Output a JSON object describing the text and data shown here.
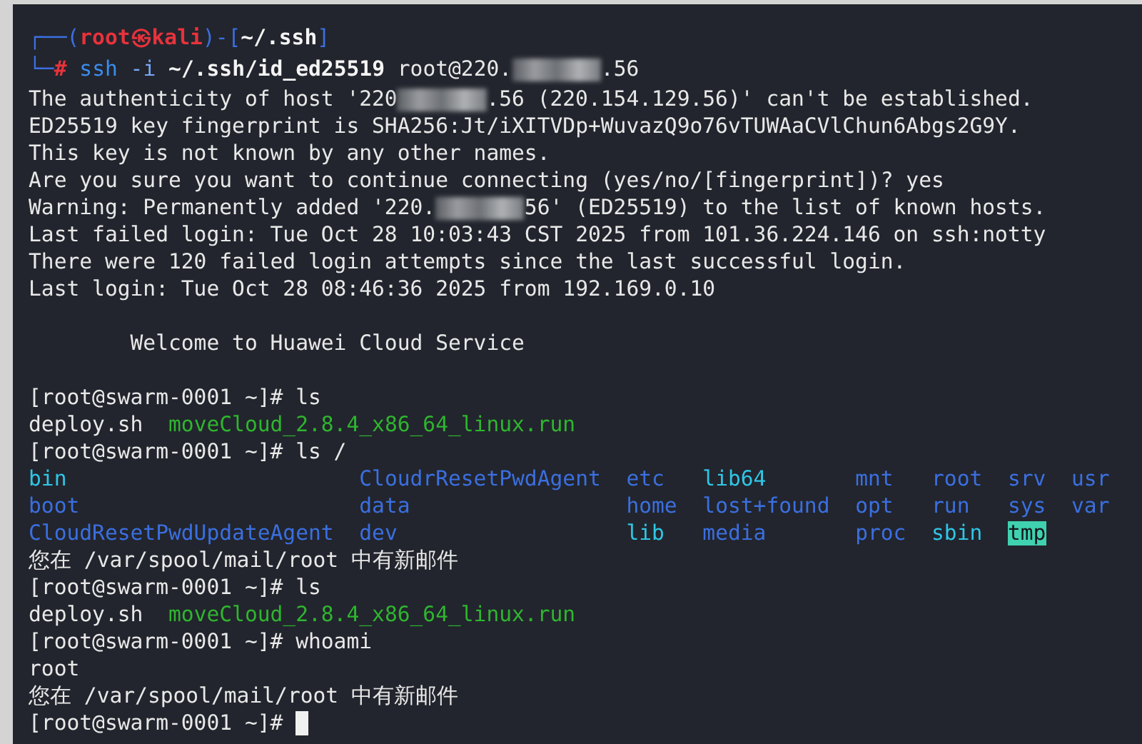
{
  "terminal": {
    "lines": [
      {
        "kind": "text",
        "segments": [
          {
            "kind": "frame",
            "text": "┌──("
          },
          {
            "kind": "user",
            "text": "root㉿kali"
          },
          {
            "kind": "frame",
            "text": ")-["
          },
          {
            "kind": "path",
            "text": "~/.ssh"
          },
          {
            "kind": "frame",
            "text": "]"
          }
        ]
      },
      {
        "kind": "text",
        "segments": [
          {
            "kind": "frame",
            "text": "└─"
          },
          {
            "kind": "user",
            "text": "#"
          },
          {
            "kind": "cmd",
            "text": " ssh"
          },
          {
            "kind": "opt",
            "text": " -i"
          },
          {
            "kind": "path",
            "text": " ~/.ssh/id_ed25519"
          },
          {
            "kind": "plain",
            "text": " root@220."
          },
          {
            "kind": "redacted"
          },
          {
            "kind": "plain",
            "text": ".56"
          }
        ]
      },
      {
        "kind": "text",
        "segments": [
          {
            "kind": "plain",
            "text": "The authenticity of host '220"
          },
          {
            "kind": "redacted"
          },
          {
            "kind": "plain",
            "text": ".56 (220.154.129.56)' can't be established."
          }
        ]
      },
      {
        "kind": "text",
        "segments": [
          {
            "kind": "plain",
            "text": "ED25519 key fingerprint is SHA256:Jt/iXITVDp+WuvazQ9o76vTUWAaCVlChun6Abgs2G9Y."
          }
        ]
      },
      {
        "kind": "text",
        "segments": [
          {
            "kind": "plain",
            "text": "This key is not known by any other names."
          }
        ]
      },
      {
        "kind": "text",
        "segments": [
          {
            "kind": "plain",
            "text": "Are you sure you want to continue connecting (yes/no/[fingerprint])? yes"
          }
        ]
      },
      {
        "kind": "text",
        "segments": [
          {
            "kind": "plain",
            "text": "Warning: Permanently added '220."
          },
          {
            "kind": "redacted"
          },
          {
            "kind": "plain",
            "text": "56' (ED25519) to the list of known hosts."
          }
        ]
      },
      {
        "kind": "text",
        "segments": [
          {
            "kind": "plain",
            "text": "Last failed login: Tue Oct 28 10:03:43 CST 2025 from 101.36.224.146 on ssh:notty"
          }
        ]
      },
      {
        "kind": "text",
        "segments": [
          {
            "kind": "plain",
            "text": "There were 120 failed login attempts since the last successful login."
          }
        ]
      },
      {
        "kind": "text",
        "segments": [
          {
            "kind": "plain",
            "text": "Last login: Tue Oct 28 08:46:36 2025 from 192.169.0.10"
          }
        ]
      },
      {
        "kind": "blank"
      },
      {
        "kind": "text",
        "segments": [
          {
            "kind": "plain",
            "text": "        Welcome to Huawei Cloud Service"
          }
        ]
      },
      {
        "kind": "blank"
      },
      {
        "kind": "text",
        "segments": [
          {
            "kind": "plain",
            "text": "[root@swarm-0001 ~]# ls"
          }
        ]
      },
      {
        "kind": "text",
        "segments": [
          {
            "kind": "plain",
            "text": "deploy.sh  "
          },
          {
            "kind": "exec",
            "text": "moveCloud_2.8.4_x86_64_linux.run"
          }
        ]
      },
      {
        "kind": "text",
        "segments": [
          {
            "kind": "plain",
            "text": "[root@swarm-0001 ~]# ls /"
          }
        ]
      },
      {
        "kind": "listing",
        "entries": [
          {
            "kind": "link",
            "text": "bin"
          },
          {
            "kind": "dir",
            "text": "boot"
          },
          {
            "kind": "dir",
            "text": "CloudResetPwdUpdateAgent"
          },
          {
            "kind": "dir",
            "text": "CloudrResetPwdAgent"
          },
          {
            "kind": "dir",
            "text": "data"
          },
          {
            "kind": "dir",
            "text": "dev"
          },
          {
            "kind": "dir",
            "text": "etc"
          },
          {
            "kind": "dir",
            "text": "home"
          },
          {
            "kind": "link",
            "text": "lib"
          },
          {
            "kind": "link",
            "text": "lib64"
          },
          {
            "kind": "dir",
            "text": "lost+found"
          },
          {
            "kind": "dir",
            "text": "media"
          },
          {
            "kind": "dir",
            "text": "mnt"
          },
          {
            "kind": "dir",
            "text": "opt"
          },
          {
            "kind": "dir",
            "text": "proc"
          },
          {
            "kind": "dir",
            "text": "root"
          },
          {
            "kind": "dir",
            "text": "run"
          },
          {
            "kind": "link",
            "text": "sbin"
          },
          {
            "kind": "dir",
            "text": "srv"
          },
          {
            "kind": "dir",
            "text": "sys"
          },
          {
            "kind": "sticky",
            "text": "tmp"
          },
          {
            "kind": "dir",
            "text": "usr"
          },
          {
            "kind": "dir",
            "text": "var"
          }
        ]
      },
      {
        "kind": "text",
        "segments": [
          {
            "kind": "plain",
            "text": "您在 /var/spool/mail/root 中有新邮件"
          }
        ]
      },
      {
        "kind": "text",
        "segments": [
          {
            "kind": "plain",
            "text": "[root@swarm-0001 ~]# ls"
          }
        ]
      },
      {
        "kind": "text",
        "segments": [
          {
            "kind": "plain",
            "text": "deploy.sh  "
          },
          {
            "kind": "exec",
            "text": "moveCloud_2.8.4_x86_64_linux.run"
          }
        ]
      },
      {
        "kind": "text",
        "segments": [
          {
            "kind": "plain",
            "text": "[root@swarm-0001 ~]# whoami"
          }
        ]
      },
      {
        "kind": "text",
        "segments": [
          {
            "kind": "plain",
            "text": "root"
          }
        ]
      },
      {
        "kind": "text",
        "segments": [
          {
            "kind": "plain",
            "text": "您在 /var/spool/mail/root 中有新邮件"
          }
        ]
      },
      {
        "kind": "text",
        "cursor": true,
        "segments": [
          {
            "kind": "plain",
            "text": "[root@swarm-0001 ~]# "
          }
        ]
      }
    ]
  }
}
